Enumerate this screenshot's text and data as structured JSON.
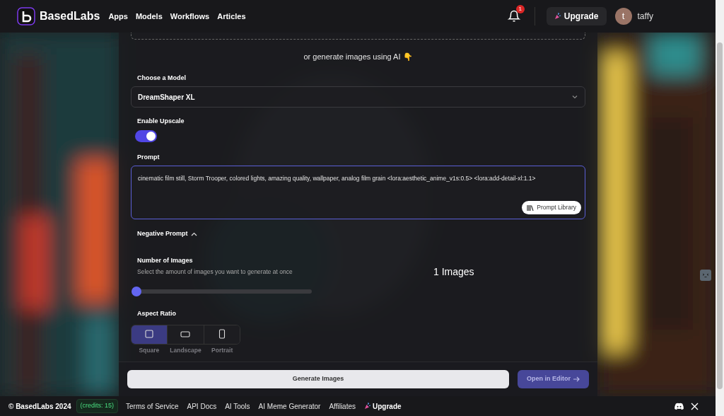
{
  "header": {
    "brand": "BasedLabs",
    "nav": [
      "Apps",
      "Models",
      "Workflows",
      "Articles"
    ],
    "notification_count": "1",
    "upgrade": "Upgrade",
    "avatar_initial": "t",
    "username": "taffy"
  },
  "form": {
    "ai_hint": "or generate images using AI 👇",
    "model": {
      "label": "Choose a Model",
      "value": "DreamShaper XL"
    },
    "upscale": {
      "label": "Enable Upscale",
      "on": true
    },
    "prompt": {
      "label": "Prompt",
      "value": "cinematic film still, Storm Trooper, colored lights, amazing quality, wallpaper, analog film grain <lora:aesthetic_anime_v1s:0.5>  <lora:add-detail-xl:1.1>",
      "library_button": "Prompt Library"
    },
    "negative_prompt": {
      "label": "Negative Prompt",
      "expanded": true
    },
    "number_of_images": {
      "label": "Number of Images",
      "description": "Select the amount of images you want to generate at once",
      "level": 0,
      "reading": "1 Images"
    },
    "aspect_ratio": {
      "label": "Aspect Ratio",
      "options": [
        {
          "kind": "square",
          "label": "Square",
          "selected": true
        },
        {
          "kind": "landscape",
          "label": "Landscape",
          "selected": false
        },
        {
          "kind": "portrait",
          "label": "Portrait",
          "selected": false
        }
      ]
    }
  },
  "actions": {
    "generate": "Generate Images",
    "editor": "Open in Editor"
  },
  "footer": {
    "copyright": "© BasedLabs 2024",
    "credits": "(credits: 15)",
    "links": [
      "Terms of Service",
      "API Docs",
      "AI Tools",
      "AI Meme Generator",
      "Affiliates"
    ],
    "upgrade": "Upgrade"
  }
}
